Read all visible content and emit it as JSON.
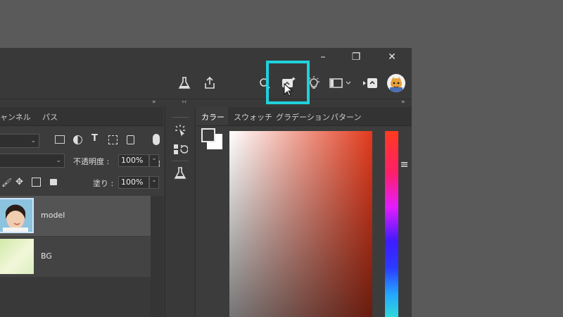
{
  "window": {
    "controls": [
      "–",
      "❐",
      "✕"
    ]
  },
  "toolbar": {
    "icons": [
      "flask-icon",
      "share-icon",
      "search-icon",
      "ai-generate-icon",
      "lightbulb-icon",
      "workspace-icon",
      "cloud-sync-icon",
      "user-avatar"
    ]
  },
  "left_panel": {
    "tabs": [
      "ャンネル",
      "パス"
    ],
    "opacity_label": "不透明度 :",
    "opacity_value": "100%",
    "fill_label": "塗り :",
    "fill_value": "100%",
    "layers": [
      {
        "name": "model"
      },
      {
        "name": "BG"
      }
    ]
  },
  "right_panel": {
    "tabs": [
      "カラー",
      "スウォッチ",
      "グラデーション",
      "パターン"
    ],
    "active_tab": "カラー"
  },
  "colors": {
    "highlight": "#1fd1dc",
    "panel": "#3c3c3c",
    "background": "#5a5a5a"
  },
  "collapse": {
    "left": "‹‹",
    "right_left": "»",
    "mid": "‹‹",
    "far_right": "»"
  }
}
